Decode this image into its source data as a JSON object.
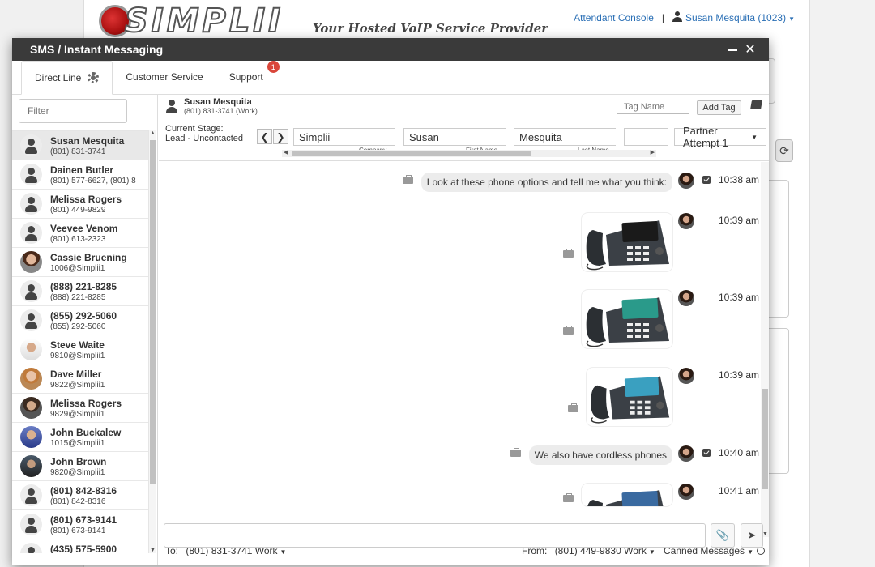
{
  "background": {
    "tagline": "Your Hosted VoIP Service Provider",
    "logo_text": "SIMPLII",
    "nav": {
      "attendant_console": "Attendant Console",
      "user": "Susan Mesquita (1023)"
    }
  },
  "modal": {
    "title": "SMS / Instant Messaging",
    "tabs": [
      {
        "label": "Direct Line"
      },
      {
        "label": "Customer Service"
      },
      {
        "label": "Support",
        "badge": "1"
      }
    ]
  },
  "sidebar": {
    "filter_placeholder": "Filter",
    "contacts": [
      {
        "name": "Susan Mesquita",
        "sub": "(801) 831-3741",
        "avatar": "person"
      },
      {
        "name": "Dainen Butler",
        "sub": "(801) 577-6627, (801) 8",
        "avatar": "person"
      },
      {
        "name": "Melissa Rogers",
        "sub": "(801) 449-9829",
        "avatar": "person"
      },
      {
        "name": "Veevee Venom",
        "sub": "(801) 613-2323",
        "avatar": "person"
      },
      {
        "name": "Cassie Bruening",
        "sub": "1006@Simplii1",
        "avatar": "photo"
      },
      {
        "name": "(888) 221-8285",
        "sub": "(888) 221-8285",
        "avatar": "person"
      },
      {
        "name": "(855) 292-5060",
        "sub": "(855) 292-5060",
        "avatar": "person"
      },
      {
        "name": "Steve Waite",
        "sub": "9810@Simplii1",
        "avatar": "photo3"
      },
      {
        "name": "Dave Miller",
        "sub": "9822@Simplii1",
        "avatar": "photo2"
      },
      {
        "name": "Melissa Rogers",
        "sub": "9829@Simplii1",
        "avatar": "photo6"
      },
      {
        "name": "John Buckalew",
        "sub": "1015@Simplii1",
        "avatar": "photo4"
      },
      {
        "name": "John Brown",
        "sub": "9820@Simplii1",
        "avatar": "photo5"
      },
      {
        "name": "(801) 842-8316",
        "sub": "(801) 842-8316",
        "avatar": "person"
      },
      {
        "name": "(801) 673-9141",
        "sub": "(801) 673-9141",
        "avatar": "person"
      },
      {
        "name": "(435) 575-5900",
        "sub": "(435) 575-5900",
        "avatar": "person"
      }
    ]
  },
  "conversation": {
    "name": "Susan Mesquita",
    "phone": "(801) 831-3741 (Work)",
    "tag_placeholder": "Tag Name",
    "add_tag": "Add Tag",
    "stage_label_1": "Current Stage:",
    "stage_label_2": "Lead - Uncontacted",
    "fields": [
      {
        "value": "Simplii",
        "label": "Company"
      },
      {
        "value": "Susan",
        "label": "First Name"
      },
      {
        "value": "Mesquita",
        "label": "Last Name"
      },
      {
        "value": "",
        "label": ""
      }
    ],
    "stage_select": "Partner Attempt 1"
  },
  "messages": [
    {
      "type": "text",
      "text": "Look at these phone options and tell me what you think:",
      "time": "10:38 am",
      "check": true
    },
    {
      "type": "image",
      "screen": "#1a1a1a",
      "time": "10:39 am"
    },
    {
      "type": "image",
      "screen": "#2a9a8a",
      "time": "10:39 am"
    },
    {
      "type": "image",
      "screen": "#3aa0c0",
      "time": "10:39 am"
    },
    {
      "type": "text",
      "text": "We also have cordless phones",
      "time": "10:40 am",
      "check": true
    },
    {
      "type": "image",
      "screen": "#3a6aa0",
      "time": "10:41 am"
    }
  ],
  "compose": {
    "to_label": "To:",
    "to_value": "(801) 831-3741 Work",
    "from_label": "From:",
    "from_value": "(801) 449-9830 Work",
    "canned": "Canned Messages"
  }
}
